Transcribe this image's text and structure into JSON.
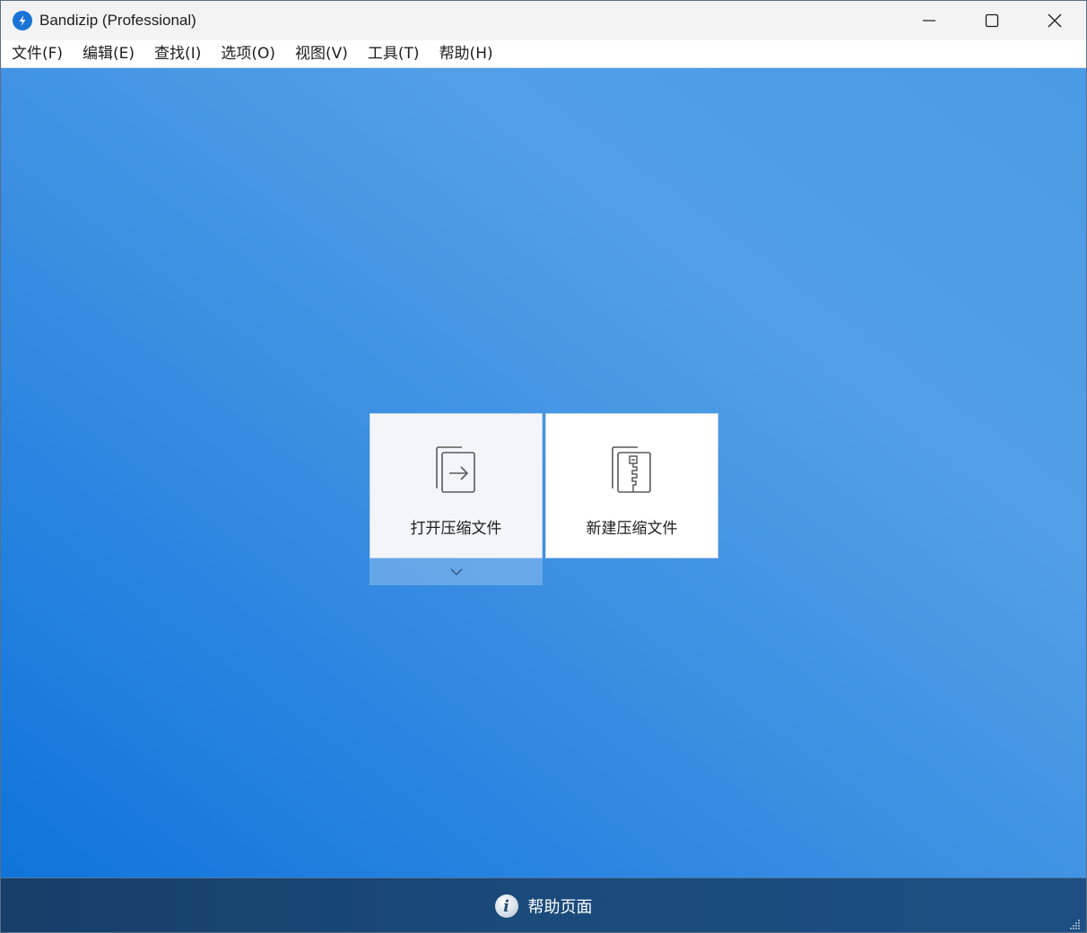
{
  "window": {
    "title": "Bandizip (Professional)",
    "app_icon": "bandizip-logo-icon",
    "controls": [
      "minimize-icon",
      "maximize-icon",
      "close-icon"
    ]
  },
  "menubar": {
    "items": [
      {
        "label": "文件(F)"
      },
      {
        "label": "编辑(E)"
      },
      {
        "label": "查找(I)"
      },
      {
        "label": "选项(O)"
      },
      {
        "label": "视图(V)"
      },
      {
        "label": "工具(T)"
      },
      {
        "label": "帮助(H)"
      }
    ]
  },
  "tiles": {
    "open": {
      "label": "打开压缩文件",
      "icon": "open-archive-icon"
    },
    "new": {
      "label": "新建压缩文件",
      "icon": "new-archive-icon"
    },
    "dropdown_icon": "chevron-down-icon"
  },
  "footer": {
    "help_label": "帮助页面",
    "help_icon": "info-icon",
    "help_icon_glyph": "i"
  },
  "colors": {
    "accent": "#1a74d8",
    "footer": "#1a4a7b",
    "tile_open_bg": "#f2f5f9",
    "tile_new_bg": "#ffffff"
  }
}
